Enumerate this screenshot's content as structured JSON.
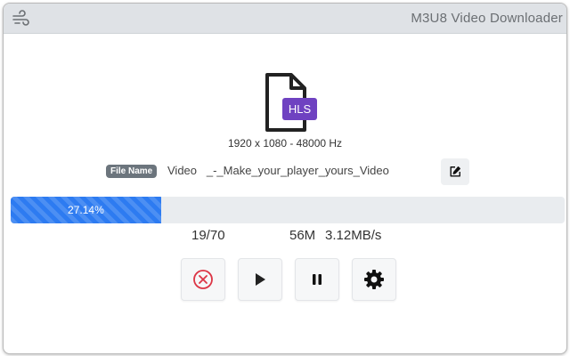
{
  "app": {
    "title": "M3U8 Video Downloader"
  },
  "media": {
    "file_type_label": "HLS",
    "info": "1920 x 1080 - 48000 Hz"
  },
  "filename": {
    "badge": "File Name",
    "value": "Video   _-_Make_your_player_yours_Video"
  },
  "progress": {
    "percent": 27.14,
    "label": "27.14%"
  },
  "stats": {
    "fragments": "19/70",
    "size": "56M",
    "speed": "3.12MB/s"
  },
  "colors": {
    "accent": "#2d7bf1",
    "hls_badge": "#6f42c1",
    "stop_red": "#dc3545"
  },
  "icons": {
    "menu": "wind-menu-icon",
    "edit": "edit-icon",
    "stop": "stop-icon",
    "play": "play-icon",
    "pause": "pause-icon",
    "settings": "gear-icon"
  }
}
